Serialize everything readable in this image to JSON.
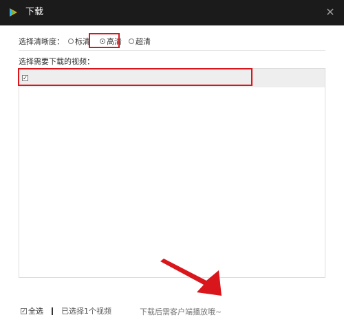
{
  "window": {
    "title": "下载",
    "close_glyph": "✕"
  },
  "quality": {
    "label": "选择清晰度：",
    "options": [
      {
        "label": "标清",
        "checked": false
      },
      {
        "label": "高清",
        "checked": true
      },
      {
        "label": "超清",
        "checked": false
      }
    ]
  },
  "video_list": {
    "label": "选择需要下载的视频：",
    "items": [
      {
        "title": "",
        "checked": true
      }
    ]
  },
  "footer": {
    "select_all_label": "全选",
    "selected_count": "已选择1个视频",
    "hint": "下载后需客户端播放哦~"
  },
  "colors": {
    "titlebar": "#1b1b1b",
    "highlight": "#d8161c",
    "row_bg": "#eeeeee"
  },
  "icons": {
    "app": "play-logo-icon",
    "close": "close-icon",
    "checkbox": "checkmark-icon"
  }
}
